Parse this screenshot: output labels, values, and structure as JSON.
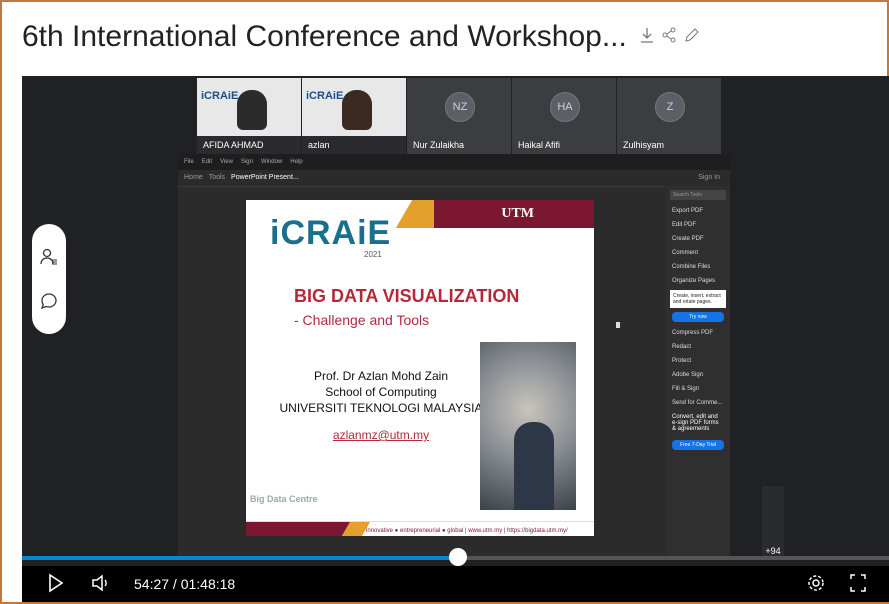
{
  "title": {
    "text": "6th International Conference and Workshop...",
    "actions": [
      "download-icon",
      "share-icon",
      "edit-icon"
    ]
  },
  "participants": [
    {
      "name": "AFIDA AHMAD",
      "type": "video"
    },
    {
      "name": "azlan",
      "type": "video"
    },
    {
      "name": "Nur Zulaikha",
      "initials": "NZ",
      "type": "avatar"
    },
    {
      "name": "Haikal Afifi",
      "initials": "HA",
      "type": "avatar"
    },
    {
      "name": "Zulhisyam",
      "initials": "Z",
      "type": "avatar"
    }
  ],
  "more_participants": "+94",
  "slide": {
    "logo": "iCRAiE",
    "logo_year": "2021",
    "utm": "UTM",
    "heading": "BIG DATA VISUALIZATION",
    "subheading": "-  Challenge and Tools",
    "author_lines": [
      "Prof. Dr Azlan Mohd Zain",
      "School of Computing",
      "UNIVERSITI TEKNOLOGI MALAYSIA"
    ],
    "email": "azlanmz@utm.my",
    "org": "Big Data Centre",
    "footer": "innovative ● entrepreneurial ● global  |  www.utm.my  |  https://bigdata.utm.my/"
  },
  "acrobat": {
    "menu": [
      "File",
      "Edit",
      "View",
      "Sign",
      "Window",
      "Help"
    ],
    "tabs": [
      "Home",
      "Tools",
      "PowerPoint Present..."
    ],
    "sign_in": "Sign In",
    "search_placeholder": "Search Tools",
    "tools": [
      "Export PDF",
      "Edit PDF",
      "Create PDF",
      "Comment",
      "Combine Files",
      "Organize Pages"
    ],
    "tip": "Create, insert, extract and rotate pages.",
    "try_now": "Try now",
    "tools2": [
      "Compress PDF",
      "Redact",
      "Protect",
      "Adobe Sign",
      "Fill & Sign",
      "Send for Comme..."
    ],
    "promo": "Convert, edit and e-sign PDF forms & agreements",
    "free_trial": "Free 7-Day Trial"
  },
  "player": {
    "time": "54:27 / 01:48:18",
    "progress_fraction": 0.503,
    "icons": [
      "play-icon",
      "volume-icon",
      "settings-icon",
      "fullscreen-icon"
    ]
  },
  "colors": {
    "frame": "#c9763a",
    "progress": "#0a84d6",
    "slide_red": "#b5283a",
    "utm_maroon": "#7b1730",
    "utm_gold": "#e3a12b"
  }
}
